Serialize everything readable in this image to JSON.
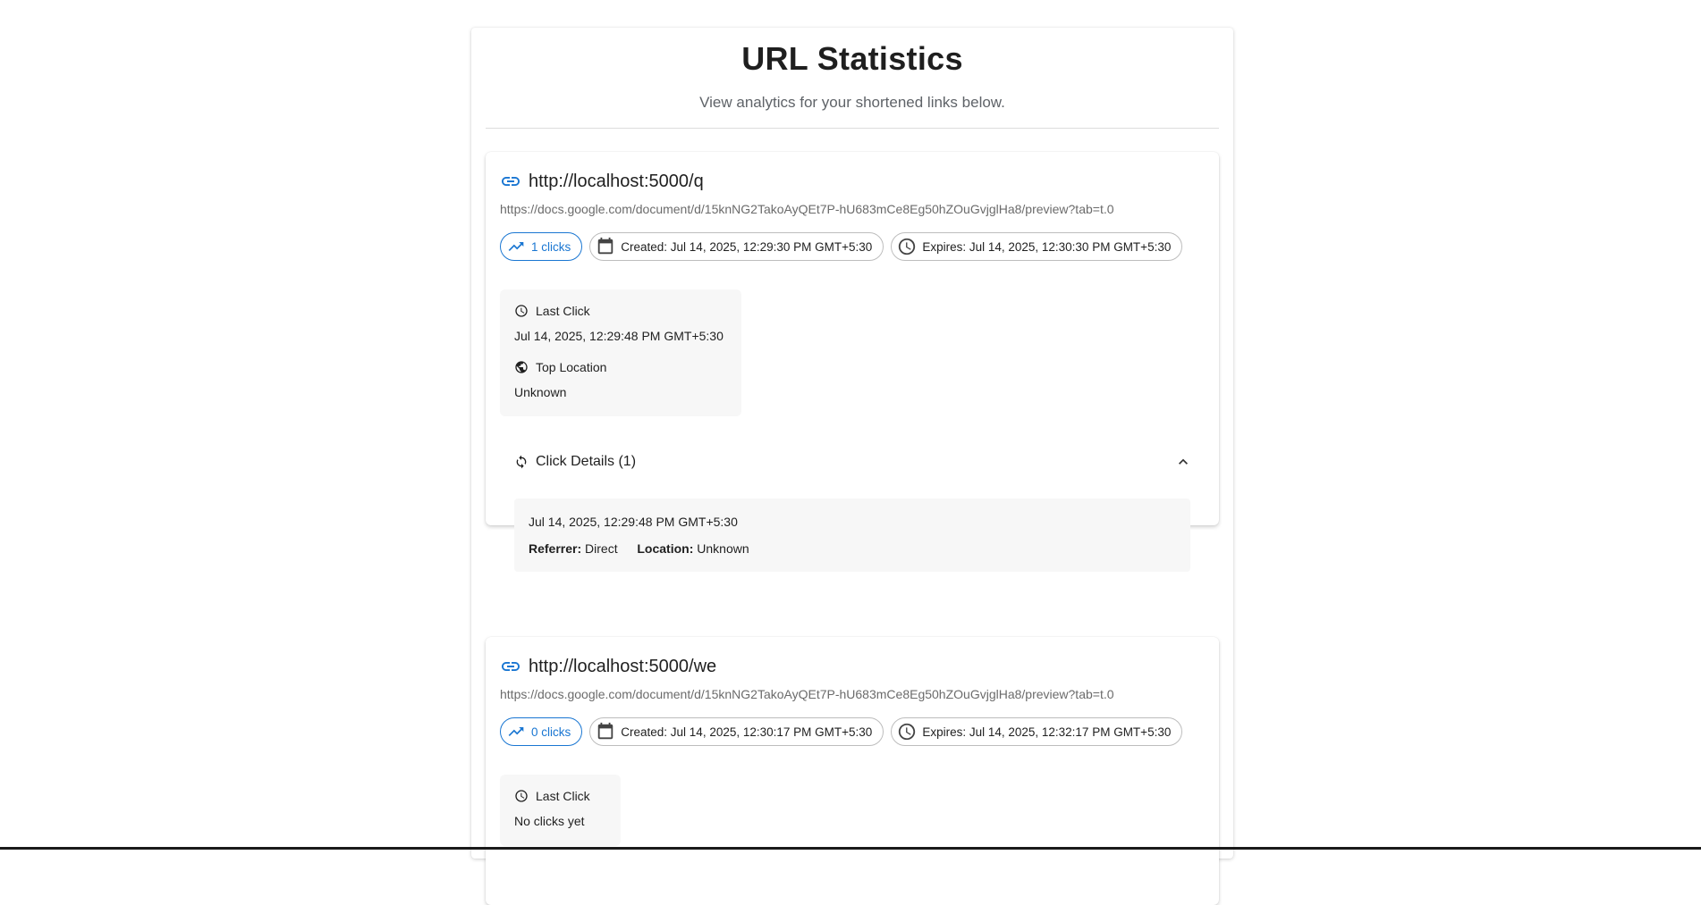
{
  "header": {
    "title": "URL Statistics",
    "subtitle": "View analytics for your shortened links below."
  },
  "cards": [
    {
      "short_url": "http://localhost:5000/q",
      "long_url": "https://docs.google.com/document/d/15knNG2TakoAyQEt7P-hU683mCe8Eg50hZOuGvjglHa8/preview?tab=t.0",
      "clicks": "1 clicks",
      "created": "Created: Jul 14, 2025, 12:29:30 PM GMT+5:30",
      "expires": "Expires: Jul 14, 2025, 12:30:30 PM GMT+5:30",
      "last_click_label": "Last Click",
      "last_click_value": "Jul 14, 2025, 12:29:48 PM GMT+5:30",
      "top_location_label": "Top Location",
      "top_location_value": "Unknown",
      "click_details_label": "Click Details (1)",
      "click_entries": [
        {
          "time": "Jul 14, 2025, 12:29:48 PM GMT+5:30",
          "referrer_label": "Referrer:",
          "referrer": "Direct",
          "location_label": "Location:",
          "location": "Unknown"
        }
      ]
    },
    {
      "short_url": "http://localhost:5000/we",
      "long_url": "https://docs.google.com/document/d/15knNG2TakoAyQEt7P-hU683mCe8Eg50hZOuGvjglHa8/preview?tab=t.0",
      "clicks": "0 clicks",
      "created": "Created: Jul 14, 2025, 12:30:17 PM GMT+5:30",
      "expires": "Expires: Jul 14, 2025, 12:32:17 PM GMT+5:30",
      "last_click_label": "Last Click",
      "last_click_value": "No clicks yet"
    }
  ],
  "colors": {
    "primary": "#1976d2",
    "muted_text": "#6b6b6b",
    "stat_bg": "#f7f7f7"
  }
}
